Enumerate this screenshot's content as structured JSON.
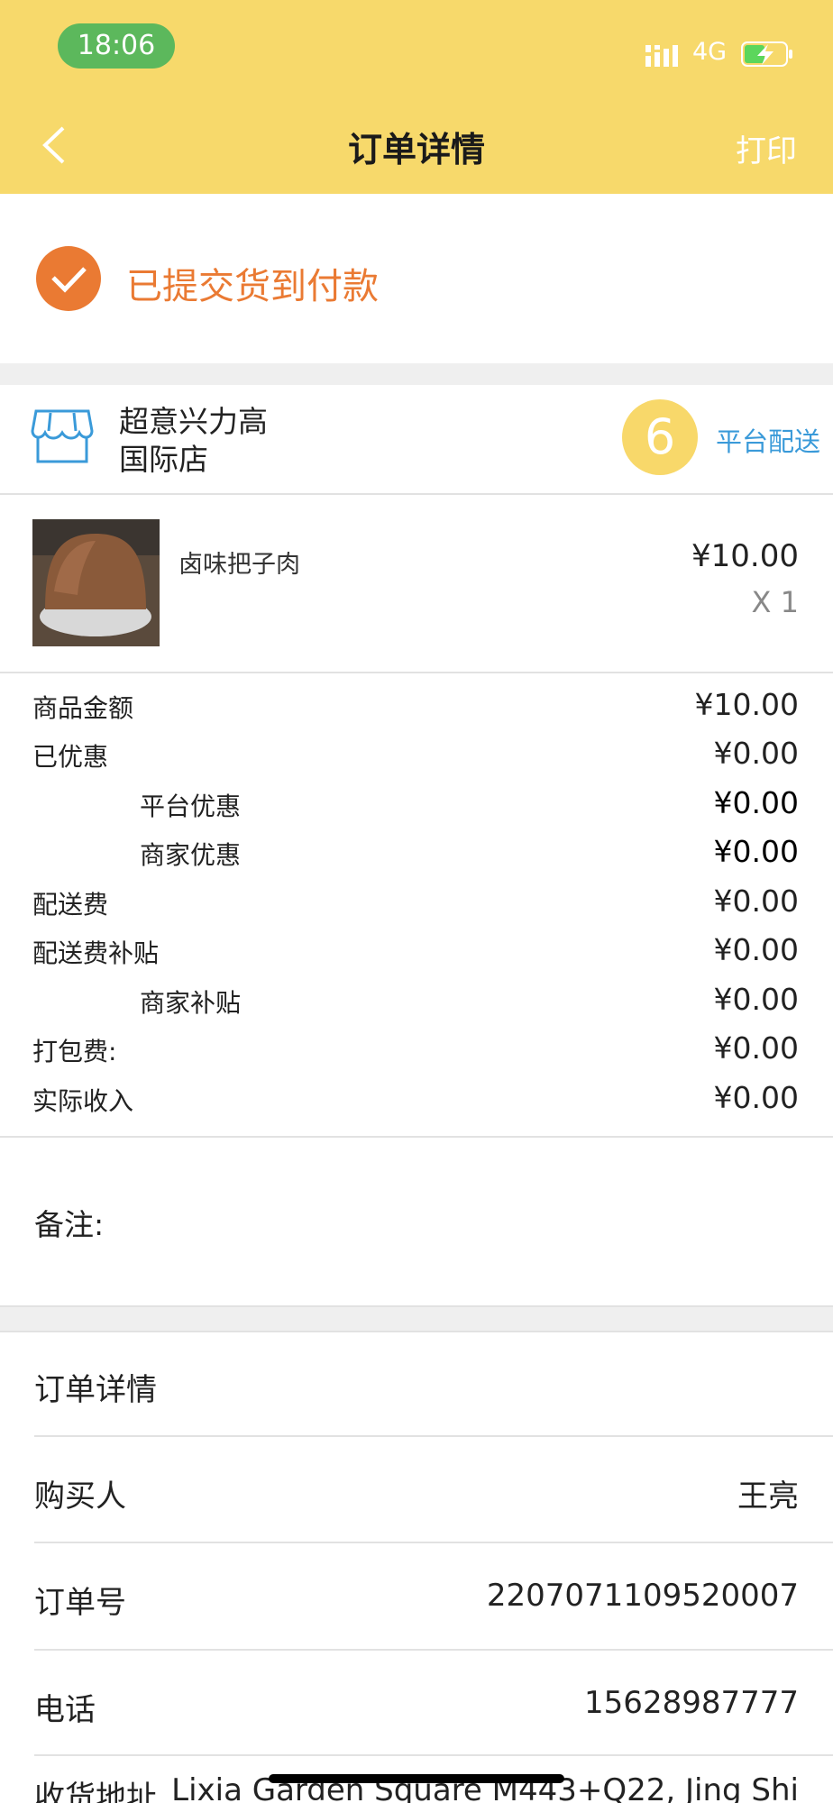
{
  "status_bar": {
    "time": "18:06",
    "network": "4G",
    "icons": [
      "signal-icon",
      "battery-charging-icon"
    ]
  },
  "nav": {
    "title": "订单详情",
    "print_label": "打印",
    "back_icon": "chevron-left-icon"
  },
  "order_status": {
    "text": "已提交货到付款",
    "icon": "check-circle-icon"
  },
  "store": {
    "name_line1": "超意兴力高",
    "name_line2": "国际店",
    "pickup_number": "6",
    "delivery_type": "平台配送",
    "icon": "store-icon"
  },
  "item": {
    "name": "卤味把子肉",
    "price": "¥10.00",
    "quantity": "X 1"
  },
  "fees": [
    {
      "label": "商品金额",
      "value": "¥10.00"
    },
    {
      "label": "已优惠",
      "value": "¥0.00"
    },
    {
      "label": "平台优惠",
      "value": "¥0.00"
    },
    {
      "label": "商家优惠",
      "value": "¥0.00"
    },
    {
      "label": "配送费",
      "value": "¥0.00"
    },
    {
      "label": "配送费补贴",
      "value": "¥0.00"
    },
    {
      "label": "商家补贴",
      "value": "¥0.00"
    },
    {
      "label": "打包费:",
      "value": "¥0.00"
    },
    {
      "label": "实际收入",
      "value": "¥0.00"
    }
  ],
  "remark": {
    "label": "备注:"
  },
  "details": {
    "section_title": "订单详情",
    "rows": [
      {
        "label": "购买人",
        "value": "王亮"
      },
      {
        "label": "订单号",
        "value": "2207071109520007"
      },
      {
        "label": "电话",
        "value": "15628987777"
      },
      {
        "label": "收货地址",
        "value": "Lixia Garden Square M443+Q22, Jing Shi"
      }
    ]
  },
  "colors": {
    "header": "#f7d96b",
    "accent_orange": "#ea7a33",
    "link_blue": "#3a9ad9",
    "status_green": "#5cb85c"
  }
}
